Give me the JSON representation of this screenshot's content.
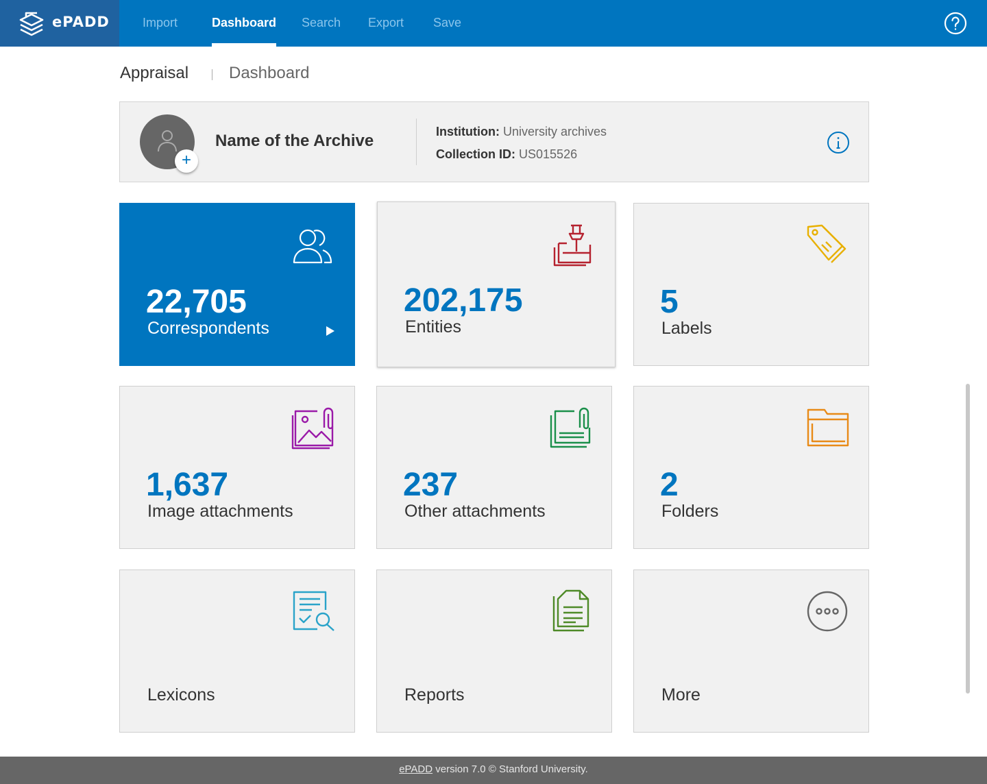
{
  "app": {
    "brand": "ePADD"
  },
  "nav": {
    "items": [
      {
        "label": "Import",
        "active": false
      },
      {
        "label": "Dashboard",
        "active": true
      },
      {
        "label": "Search",
        "active": false
      },
      {
        "label": "Export",
        "active": false
      },
      {
        "label": "Save",
        "active": false
      }
    ],
    "help_icon": "question-circle-icon"
  },
  "breadcrumb": {
    "section": "Appraisal",
    "page": "Dashboard"
  },
  "archive": {
    "name": "Name of the Archive",
    "institution_label": "Institution:",
    "institution_value": "University archives",
    "collection_label": "Collection ID:",
    "collection_value": "US015526",
    "avatar_add": "+",
    "info_icon": "info-circle-icon"
  },
  "tiles": [
    {
      "count": "22,705",
      "label": "Correspondents",
      "icon": "correspondents-icon",
      "color": "#ffffff"
    },
    {
      "count": "202,175",
      "label": "Entities",
      "icon": "entities-pin-icon",
      "color": "#b5222f"
    },
    {
      "count": "5",
      "label": "Labels",
      "icon": "labels-tag-icon",
      "color": "#e8b000"
    },
    {
      "count": "1,637",
      "label": "Image attachments",
      "icon": "image-attachment-icon",
      "color": "#9a1aa8"
    },
    {
      "count": "237",
      "label": "Other attachments",
      "icon": "other-attachment-icon",
      "color": "#1a8f4a"
    },
    {
      "count": "2",
      "label": "Folders",
      "icon": "folder-icon",
      "color": "#e88a17"
    },
    {
      "count": "",
      "label": "Lexicons",
      "icon": "lexicons-icon",
      "color": "#2aa3c9"
    },
    {
      "count": "",
      "label": "Reports",
      "icon": "reports-icon",
      "color": "#4e8a28"
    },
    {
      "count": "",
      "label": "More",
      "icon": "more-dots-icon",
      "color": "#666666"
    }
  ],
  "colors": {
    "accent": "#0075bf",
    "brand_dark": "#1f62a0",
    "footer": "#666666"
  },
  "footer": {
    "link": "ePADD",
    "text": " version 7.0 © Stanford University."
  }
}
